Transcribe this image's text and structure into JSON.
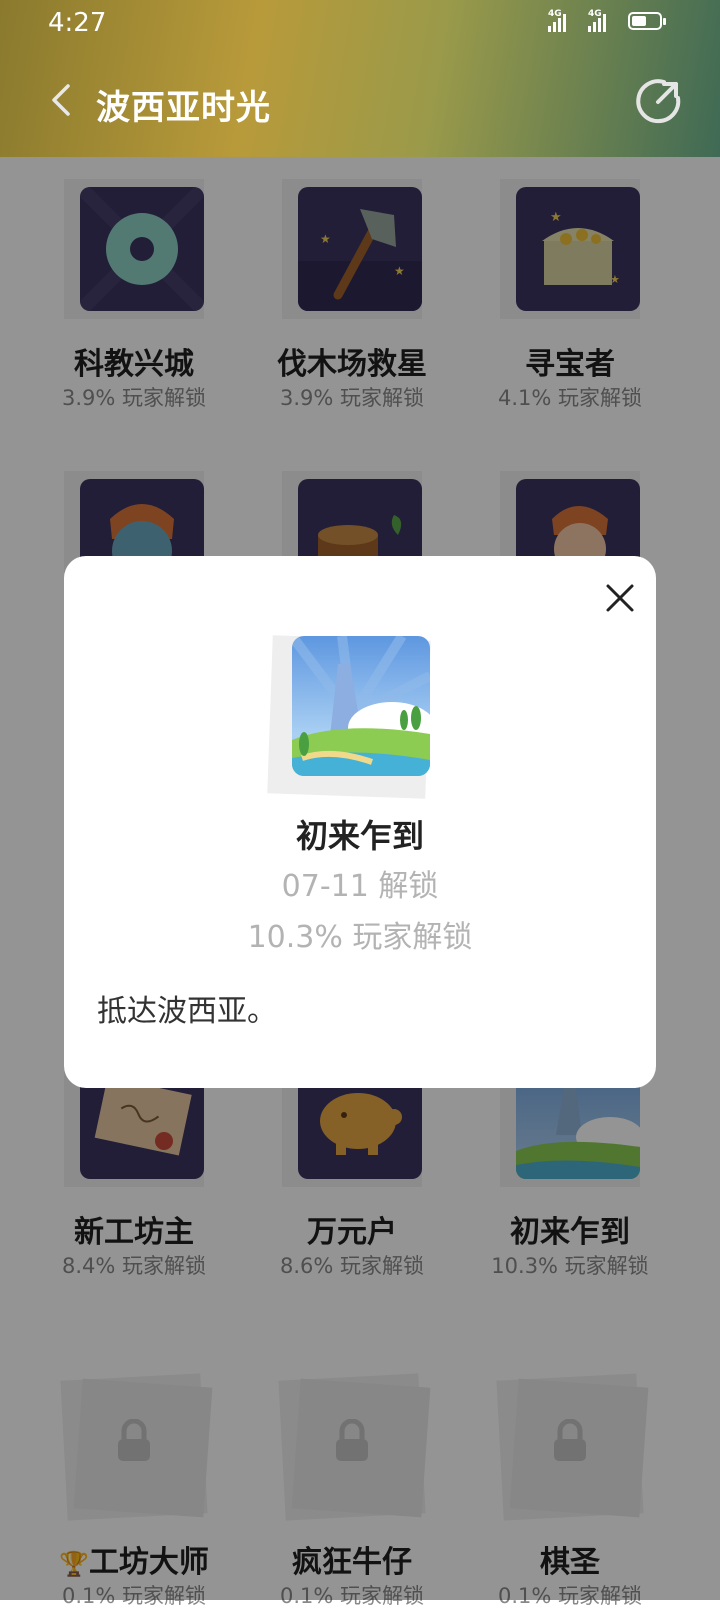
{
  "status_bar": {
    "time": "4:27",
    "signal_label_1": "4G",
    "signal_label_2": "4G",
    "battery_level": 0.45
  },
  "header": {
    "title": "波西亚时光"
  },
  "achievements": [
    {
      "name": "科教兴城",
      "unlock_rate": "3.9% 玩家解锁",
      "icon": "disc-icon"
    },
    {
      "name": "伐木场救星",
      "unlock_rate": "3.9% 玩家解锁",
      "icon": "axe-icon"
    },
    {
      "name": "寻宝者",
      "unlock_rate": "4.1% 玩家解锁",
      "icon": "treasure-chest-icon"
    },
    {
      "name": "新工坊主",
      "unlock_rate": "8.4% 玩家解锁",
      "icon": "certificate-icon"
    },
    {
      "name": "万元户",
      "unlock_rate": "8.6% 玩家解锁",
      "icon": "piggy-bank-icon"
    },
    {
      "name": "初来乍到",
      "unlock_rate": "10.3% 玩家解锁",
      "icon": "landscape-icon"
    },
    {
      "name": "工坊大师",
      "unlock_rate": "0.1% 玩家解锁",
      "icon": "trophy-icon"
    },
    {
      "name": "疯狂牛仔",
      "unlock_rate": "0.1% 玩家解锁",
      "icon": "lock-icon"
    },
    {
      "name": "棋圣",
      "unlock_rate": "0.1% 玩家解锁",
      "icon": "lock-icon"
    }
  ],
  "modal": {
    "title": "初来乍到",
    "date": "07-11 解锁",
    "unlock_rate": "10.3% 玩家解锁",
    "description": "抵达波西亚。"
  }
}
